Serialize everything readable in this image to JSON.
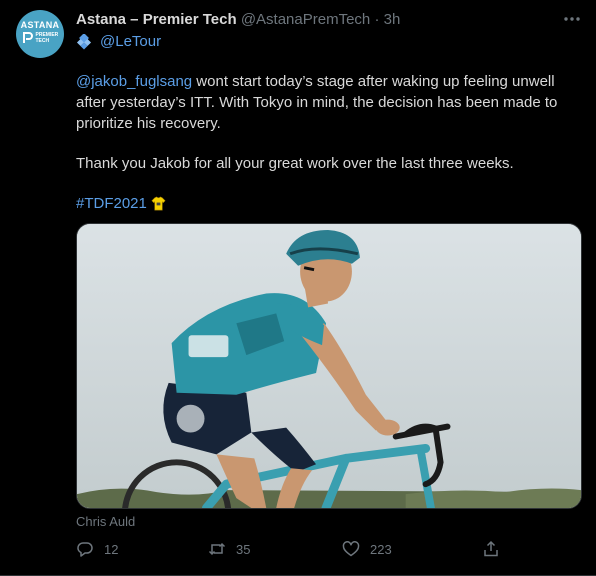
{
  "author": {
    "avatar_brand": "ASTANA",
    "avatar_sub": "PREMIER TECH",
    "name": "Astana – Premier Tech",
    "handle": "@AstanaPremTech",
    "separator": "·",
    "time": "3h"
  },
  "venue": {
    "icon": "tour-de-france-icon",
    "label": "@LeTour"
  },
  "tweet": {
    "mention": "@jakob_fuglsang",
    "paragraph1_rest": " wont start today’s stage after waking up feeling unwell after yesterday’s ITT. With Tokyo in mind, the decision has been made to prioritize his recovery.",
    "paragraph2": "Thank you Jakob for all your great work over the last three weeks.",
    "hashtag": "#TDF2021",
    "hashtag_icon": "yellow-jersey-icon"
  },
  "media": {
    "alt_subject": "cyclist",
    "credit": "Chris Auld"
  },
  "actions": {
    "reply_count": "12",
    "retweet_count": "35",
    "like_count": "223"
  },
  "colors": {
    "background": "#000000",
    "link": "#5b9ee6",
    "muted": "#6e767d",
    "avatar": "#49a3c4"
  }
}
